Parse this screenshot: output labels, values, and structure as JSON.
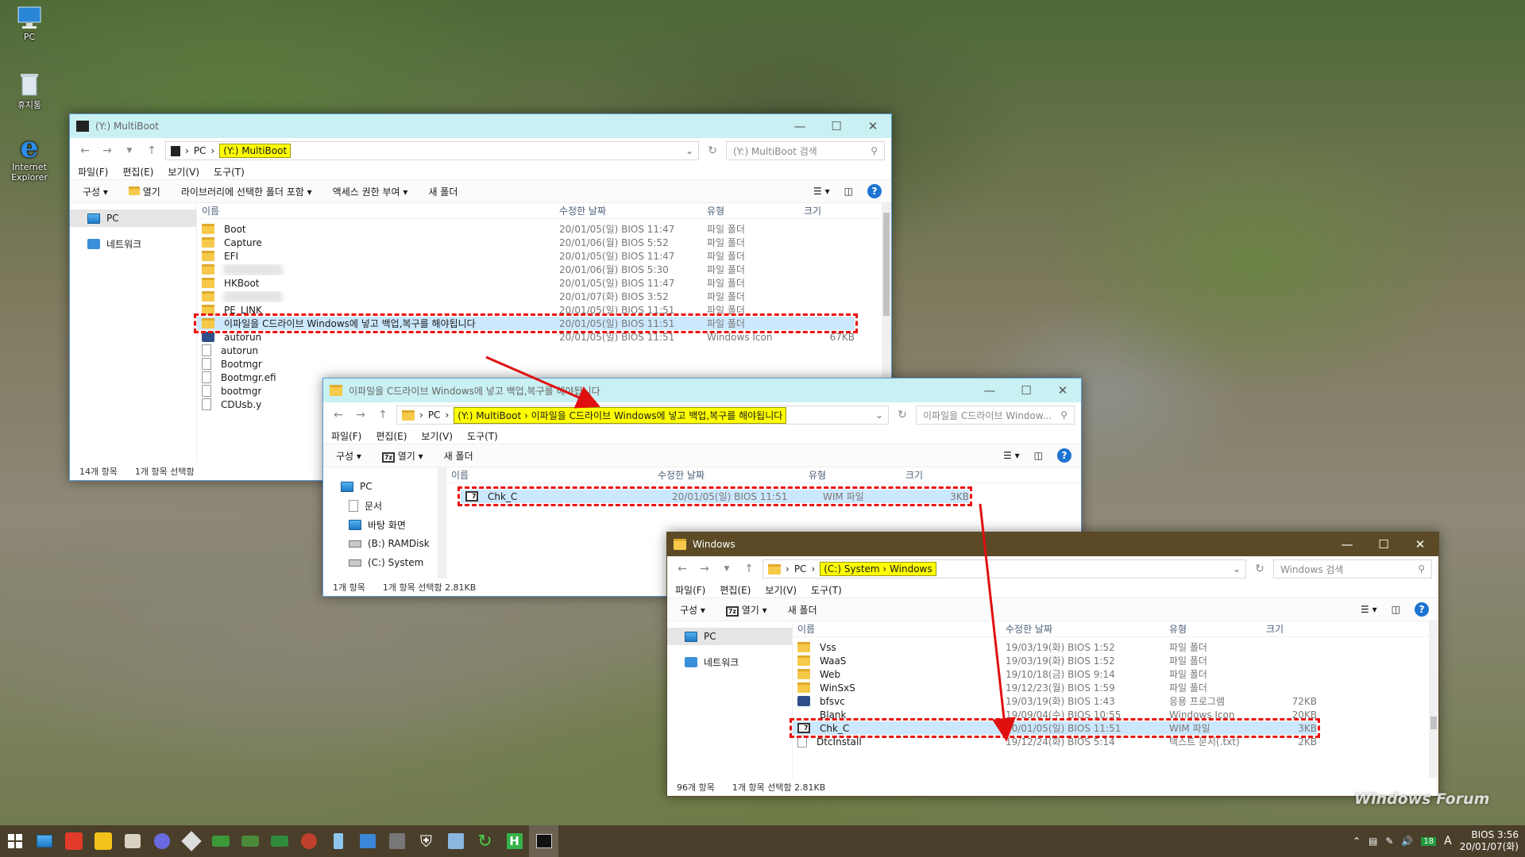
{
  "desktop": {
    "icons": [
      {
        "label": "PC",
        "icon": "computer-icon"
      },
      {
        "label": "휴지통",
        "icon": "recycle-bin-icon"
      },
      {
        "label": "Internet Explorer",
        "icon": "ie-icon"
      }
    ],
    "watermark": "Windows Forum"
  },
  "win1": {
    "title": "(Y:) MultiBoot",
    "address": [
      "PC",
      "(Y:) MultiBoot"
    ],
    "search_placeholder": "(Y:) MultiBoot 검색",
    "menu": [
      "파일(F)",
      "편집(E)",
      "보기(V)",
      "도구(T)"
    ],
    "commands": [
      "구성",
      "열기",
      "라이브러리에 선택한 폴더 포함",
      "액세스 권한 부여",
      "새 폴더"
    ],
    "nav": [
      "PC",
      "네트워크"
    ],
    "columns": [
      "이름",
      "수정한 날짜",
      "유형",
      "크기"
    ],
    "rows": [
      {
        "name": "Boot",
        "date": "20/01/05(일) BIOS  11:47",
        "type": "파일 폴더",
        "size": "",
        "icon": "folder-icon"
      },
      {
        "name": "Capture",
        "date": "20/01/06(월) BIOS  5:52",
        "type": "파일 폴더",
        "size": "",
        "icon": "folder-icon"
      },
      {
        "name": "EFI",
        "date": "20/01/05(일) BIOS  11:47",
        "type": "파일 폴더",
        "size": "",
        "icon": "folder-icon"
      },
      {
        "name": "",
        "date": "20/01/06(월) BIOS  5:30",
        "type": "파일 폴더",
        "size": "",
        "icon": "folder-icon",
        "blurred": true
      },
      {
        "name": "HKBoot",
        "date": "20/01/05(일) BIOS  11:47",
        "type": "파일 폴더",
        "size": "",
        "icon": "folder-icon"
      },
      {
        "name": "",
        "date": "20/01/07(화) BIOS  3:52",
        "type": "파일 폴더",
        "size": "",
        "icon": "folder-icon",
        "blurred": true
      },
      {
        "name": "PE_LINK",
        "date": "20/01/05(일) BIOS  11:51",
        "type": "파일 폴더",
        "size": "",
        "icon": "folder-icon"
      },
      {
        "name": "이파일을 C드라이브 Windows에 넣고 백업,복구를 해야됩니다",
        "date": "20/01/05(일) BIOS  11:51",
        "type": "파일 폴더",
        "size": "",
        "icon": "folder-icon",
        "highlight": true
      },
      {
        "name": "autorun",
        "date": "20/01/05(일) BIOS  11:51",
        "type": "Windows Icon",
        "size": "67KB",
        "icon": "app-icon"
      },
      {
        "name": "autorun",
        "date": "",
        "type": "",
        "size": "",
        "icon": "doc-icon"
      },
      {
        "name": "Bootmgr",
        "date": "",
        "type": "",
        "size": "",
        "icon": "doc-icon"
      },
      {
        "name": "Bootmgr.efi",
        "date": "",
        "type": "",
        "size": "",
        "icon": "doc-icon"
      },
      {
        "name": "bootmgr",
        "date": "",
        "type": "",
        "size": "",
        "icon": "doc-icon"
      },
      {
        "name": "CDUsb.y",
        "date": "",
        "type": "",
        "size": "",
        "icon": "doc-icon"
      }
    ],
    "status": [
      "14개 항목",
      "1개 항목 선택함"
    ]
  },
  "win2": {
    "title": "이파일을 C드라이브 Windows에 넣고 백업,복구를 해야됩니다",
    "address": [
      "PC",
      "(Y:) MultiBoot",
      "이파일을 C드라이브 Windows에 넣고 백업,복구를 해야됩니다"
    ],
    "search_placeholder": "이파일을 C드라이브 Window...",
    "menu": [
      "파일(F)",
      "편집(E)",
      "보기(V)",
      "도구(T)"
    ],
    "commands": [
      "구성",
      "열기",
      "새 폴더"
    ],
    "nav": [
      "PC",
      "문서",
      "바탕 화면",
      "(B:) RAMDisk",
      "(C:) System"
    ],
    "columns": [
      "이름",
      "수정한 날짜",
      "유형",
      "크기"
    ],
    "rows": [
      {
        "name": "Chk_C",
        "date": "20/01/05(일) BIOS  11:51",
        "type": "WIM 파일",
        "size": "3KB"
      }
    ],
    "status": [
      "1개 항목",
      "1개 항목 선택함 2.81KB"
    ]
  },
  "win3": {
    "title": "Windows",
    "address": [
      "PC",
      "(C:) System",
      "Windows"
    ],
    "search_placeholder": "Windows 검색",
    "menu": [
      "파일(F)",
      "편집(E)",
      "보기(V)",
      "도구(T)"
    ],
    "commands": [
      "구성",
      "열기",
      "새 폴더"
    ],
    "nav": [
      "PC",
      "네트워크"
    ],
    "columns": [
      "이름",
      "수정한 날짜",
      "유형",
      "크기"
    ],
    "rows": [
      {
        "name": "Vss",
        "date": "19/03/19(화) BIOS  1:52",
        "type": "파일 폴더",
        "size": "",
        "icon": "folder-icon"
      },
      {
        "name": "WaaS",
        "date": "19/03/19(화) BIOS  1:52",
        "type": "파일 폴더",
        "size": "",
        "icon": "folder-icon"
      },
      {
        "name": "Web",
        "date": "19/10/18(금) BIOS  9:14",
        "type": "파일 폴더",
        "size": "",
        "icon": "folder-icon"
      },
      {
        "name": "WinSxS",
        "date": "19/12/23(월) BIOS  1:59",
        "type": "파일 폴더",
        "size": "",
        "icon": "folder-icon"
      },
      {
        "name": "bfsvc",
        "date": "19/03/19(화) BIOS  1:43",
        "type": "응용 프로그램",
        "size": "72KB",
        "icon": "app-icon"
      },
      {
        "name": "Blank",
        "date": "19/09/04(수) BIOS  10:55",
        "type": "Windows Icon",
        "size": "20KB",
        "icon": "blank-icon"
      },
      {
        "name": "Chk_C",
        "date": "20/01/05(일) BIOS  11:51",
        "type": "WIM 파일",
        "size": "3KB",
        "icon": "wim-icon",
        "highlight": true
      },
      {
        "name": "DtcInstall",
        "date": "19/12/24(화) BIOS  5:14",
        "type": "텍스트 문서(.txt)",
        "size": "2KB",
        "icon": "doc-icon"
      }
    ],
    "status": [
      "96개 항목",
      "1개 항목 선택함 2.81KB"
    ]
  },
  "taskbar": {
    "items": [
      "start-icon",
      "explorer-icon",
      "app-red-icon",
      "player-icon",
      "app-icon",
      "browser-icon",
      "tool-icon",
      "app-icon",
      "app-icon",
      "app-icon",
      "app-icon",
      "app-icon",
      "app-icon",
      "app-icon",
      "shield-icon",
      "app-icon",
      "refresh-icon",
      "h-icon",
      "terminal-icon"
    ],
    "tray_badge": "18",
    "ime": "A",
    "clock_time": "BIOS  3:56",
    "clock_date": "20/01/07(화)"
  }
}
